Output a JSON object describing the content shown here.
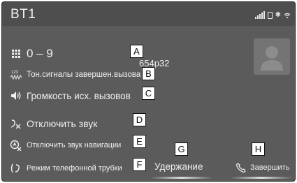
{
  "screen": {
    "title": "BT1",
    "status_icons": [
      "signal-bars-icon",
      "battery-icon",
      "bluetooth-icon",
      "wifi-icon"
    ]
  },
  "menu": {
    "keypad": {
      "label": "0 – 9",
      "icon": "keypad-icon"
    },
    "tones": {
      "label": "Тон.сигналы завершен.вызова",
      "icon": "tone-signal-icon"
    },
    "volume": {
      "label": "Громкость исх. вызовов",
      "icon": "speaker-volume-icon"
    },
    "mute": {
      "label": "Отключить звук",
      "icon": "microphone-mute-icon"
    },
    "mute_navigation": {
      "label": "Отключить звук навигации",
      "icon": "navigation-mute-icon"
    },
    "handset": {
      "label": "Режим телефонной трубки",
      "icon": "handset-mode-icon"
    }
  },
  "call": {
    "number_partial": "654p32",
    "avatar_icon": "contact-avatar-icon"
  },
  "actions": {
    "hold_label": "Удержание",
    "end_label": "Завершить",
    "end_icon": "phone-hangup-icon"
  },
  "callouts": {
    "a": "A",
    "b": "B",
    "c": "C",
    "d": "D",
    "e": "E",
    "f": "F",
    "g": "G",
    "h": "H"
  }
}
